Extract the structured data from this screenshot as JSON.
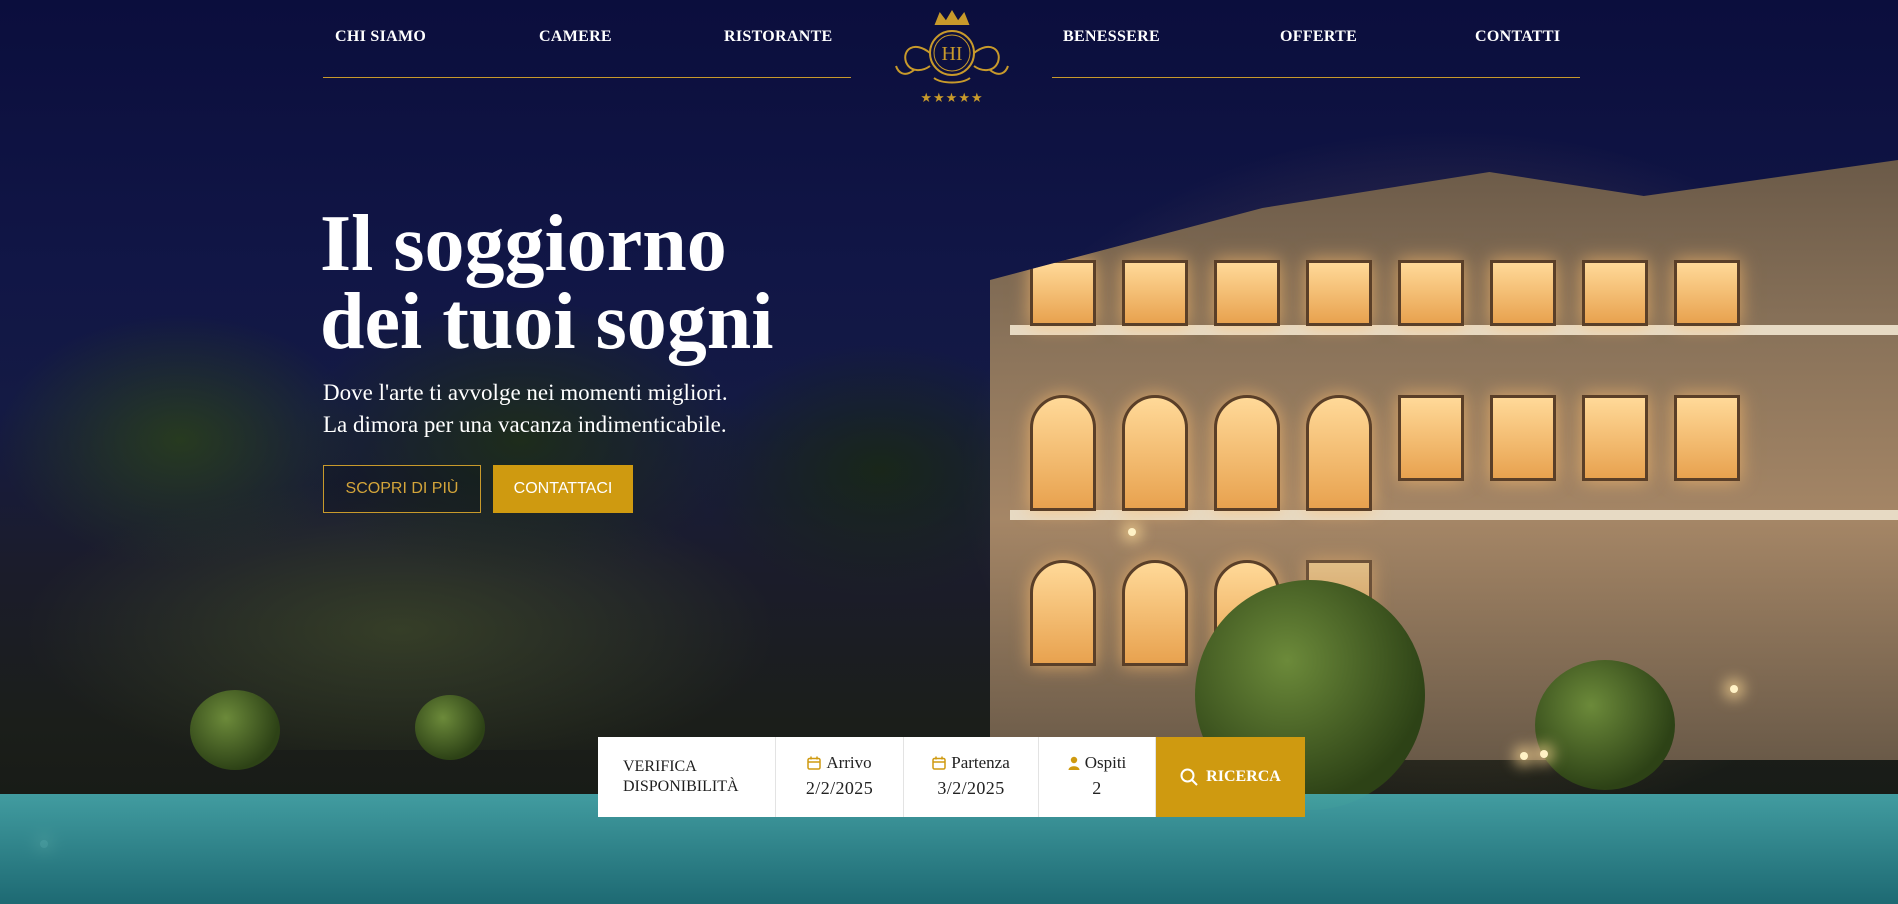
{
  "nav": {
    "left": [
      "CHI SIAMO",
      "CAMERE",
      "RISTORANTE"
    ],
    "right": [
      "BENESSERE",
      "OFFERTE",
      "CONTATTI"
    ]
  },
  "logo": {
    "monogram": "HI",
    "stars": "★★★★★",
    "accent_color": "#c89a2b"
  },
  "hero": {
    "headline_line1": "Il soggiorno",
    "headline_line2": "dei tuoi sogni",
    "subline_1": "Dove l'arte ti avvolge nei momenti migliori.",
    "subline_2": "La dimora per una vacanza indimenticabile.",
    "btn_discover": "SCOPRI DI PIÙ",
    "btn_contact": "CONTATTACI"
  },
  "booking": {
    "title_line1": "VERIFICA",
    "title_line2": "DISPONIBILITÀ",
    "arrival_label": "Arrivo",
    "arrival_value": "2/2/2025",
    "departure_label": "Partenza",
    "departure_value": "3/2/2025",
    "guests_label": "Ospiti",
    "guests_value": "2",
    "search_label": "RICERCA",
    "accent_color": "#cf9a10"
  }
}
